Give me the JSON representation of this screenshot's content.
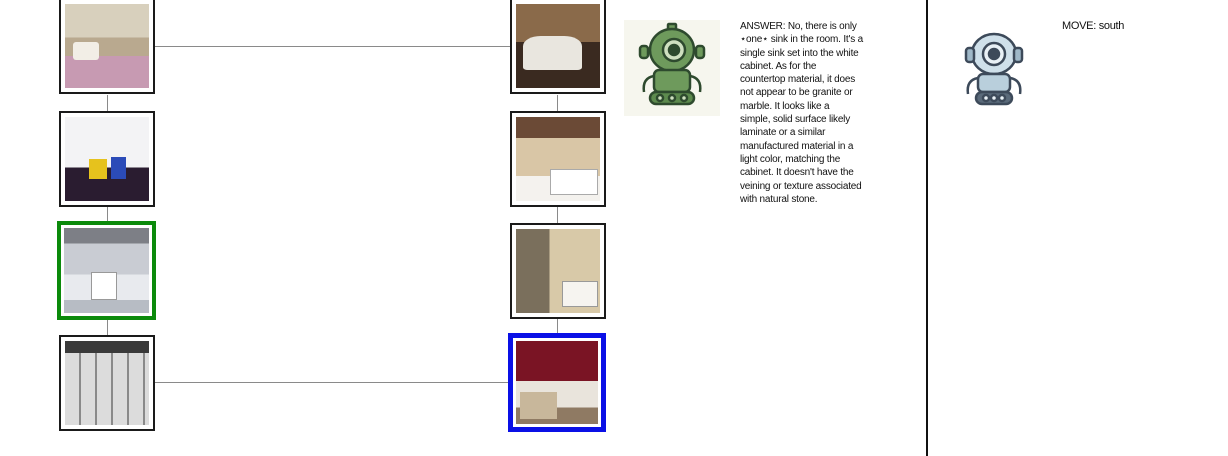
{
  "graph": {
    "nodes": [
      {
        "id": "n1",
        "room": "bedroom",
        "state": "normal"
      },
      {
        "id": "n2",
        "room": "kids-room",
        "state": "normal"
      },
      {
        "id": "n3",
        "room": "bathroom",
        "state": "current"
      },
      {
        "id": "n4",
        "room": "closet",
        "state": "normal"
      },
      {
        "id": "n5",
        "room": "garage",
        "state": "normal"
      },
      {
        "id": "n6",
        "room": "bathroom",
        "state": "normal"
      },
      {
        "id": "n7",
        "room": "bathroom",
        "state": "normal"
      },
      {
        "id": "n8",
        "room": "bathroom",
        "state": "target"
      }
    ],
    "colors": {
      "current": "#0b8a0b",
      "target": "#0a10e6",
      "edge": "#8a8a8a"
    }
  },
  "agent_icon": "robot-icon",
  "answer": {
    "text": "ANSWER: No, there is only\n⋆one⋆ sink in the room. It's a\nsingle sink set into the white\ncabinet.  As for the\ncountertop material, it does\nnot appear to be granite or\nmarble. It looks like a\nsimple, solid surface likely\nlaminate or a similar\nmanufactured material in a\nlight color, matching the\ncabinet. It doesn't have the\nveining or texture associated\nwith natural stone."
  },
  "move": {
    "text": "MOVE: south"
  }
}
